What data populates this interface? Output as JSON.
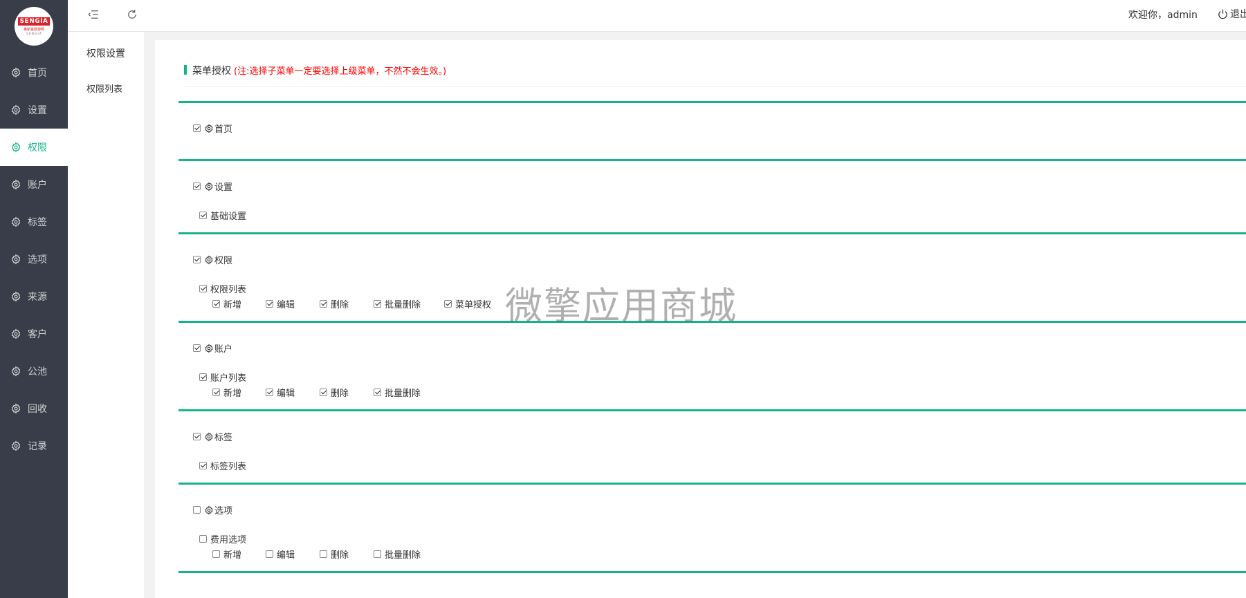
{
  "logo": {
    "brand": "SENGIA",
    "line1": "奥斯金旅游网",
    "line2": "S E N G I A"
  },
  "sidebar": {
    "items": [
      {
        "label": "首页",
        "icon": "gear-icon",
        "active": false
      },
      {
        "label": "设置",
        "icon": "gear-icon",
        "active": false
      },
      {
        "label": "权限",
        "icon": "gear-icon",
        "active": true
      },
      {
        "label": "账户",
        "icon": "gear-icon",
        "active": false
      },
      {
        "label": "标签",
        "icon": "gear-icon",
        "active": false
      },
      {
        "label": "选项",
        "icon": "gear-icon",
        "active": false
      },
      {
        "label": "来源",
        "icon": "gear-icon",
        "active": false
      },
      {
        "label": "客户",
        "icon": "gear-icon",
        "active": false
      },
      {
        "label": "公池",
        "icon": "gear-icon",
        "active": false
      },
      {
        "label": "回收",
        "icon": "gear-icon",
        "active": false
      },
      {
        "label": "记录",
        "icon": "gear-icon",
        "active": false
      }
    ]
  },
  "header": {
    "menu_icon": "indent-icon",
    "refresh_icon": "refresh-icon",
    "welcome": "欢迎你，admin",
    "logout": "退出",
    "logout_icon": "power-icon"
  },
  "subnav": {
    "items": [
      "权限设置",
      "权限列表"
    ]
  },
  "section": {
    "title": "菜单授权",
    "note": "(注:选择子菜单一定要选择上级菜单，不然不会生效。)"
  },
  "groups": [
    {
      "label": "首页",
      "checked": true,
      "children": []
    },
    {
      "label": "设置",
      "checked": true,
      "children": [
        {
          "label": "基础设置",
          "checked": true,
          "actions": []
        }
      ]
    },
    {
      "label": "权限",
      "checked": true,
      "children": [
        {
          "label": "权限列表",
          "checked": true,
          "actions": [
            {
              "label": "新增",
              "checked": true
            },
            {
              "label": "编辑",
              "checked": true
            },
            {
              "label": "删除",
              "checked": true
            },
            {
              "label": "批量删除",
              "checked": true
            },
            {
              "label": "菜单授权",
              "checked": true
            }
          ]
        }
      ]
    },
    {
      "label": "账户",
      "checked": true,
      "children": [
        {
          "label": "账户列表",
          "checked": true,
          "actions": [
            {
              "label": "新增",
              "checked": true
            },
            {
              "label": "编辑",
              "checked": true
            },
            {
              "label": "删除",
              "checked": true
            },
            {
              "label": "批量删除",
              "checked": true
            }
          ]
        }
      ]
    },
    {
      "label": "标签",
      "checked": true,
      "children": [
        {
          "label": "标签列表",
          "checked": true,
          "actions": []
        }
      ]
    },
    {
      "label": "选项",
      "checked": false,
      "children": [
        {
          "label": "费用选项",
          "checked": false,
          "actions": [
            {
              "label": "新增",
              "checked": false
            },
            {
              "label": "编辑",
              "checked": false
            },
            {
              "label": "删除",
              "checked": false
            },
            {
              "label": "批量删除",
              "checked": false
            }
          ]
        }
      ]
    }
  ],
  "watermark": "微擎应用商城",
  "colors": {
    "sidebar_bg": "#393d49",
    "accent": "#16b28a",
    "note_red": "#ff0000"
  }
}
